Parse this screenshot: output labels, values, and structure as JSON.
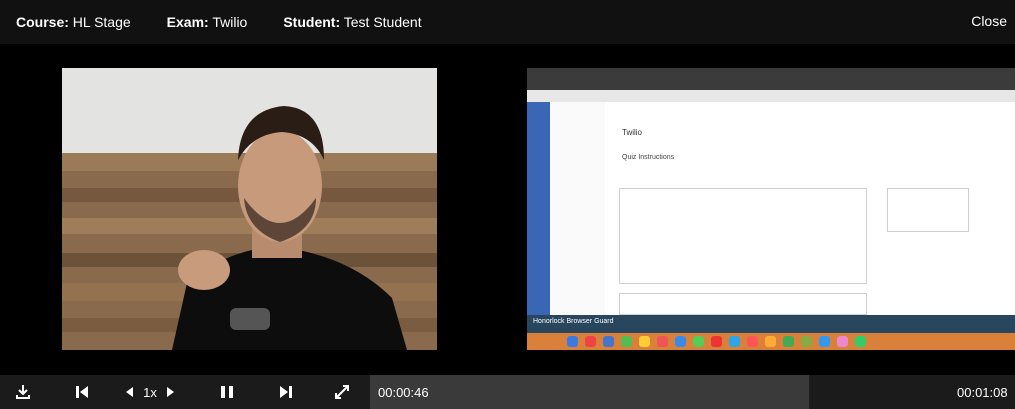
{
  "header": {
    "course_label": "Course:",
    "course_value": "HL Stage",
    "exam_label": "Exam:",
    "exam_value": "Twilio",
    "student_label": "Student:",
    "student_value": "Test Student",
    "close_label": "Close"
  },
  "playback": {
    "speed": "1x",
    "current_time": "00:00:46",
    "total_time": "00:01:08",
    "progress": 0.68
  },
  "screen_share": {
    "quiz_title": "Twilio",
    "quiz_instructions": "Quiz Instructions",
    "brand": "Honorlock Browser Guard"
  },
  "icons": [
    "download-icon",
    "skip-back-icon",
    "speed-down-icon",
    "speed-up-icon",
    "pause-icon",
    "skip-forward-icon",
    "fullscreen-icon"
  ]
}
